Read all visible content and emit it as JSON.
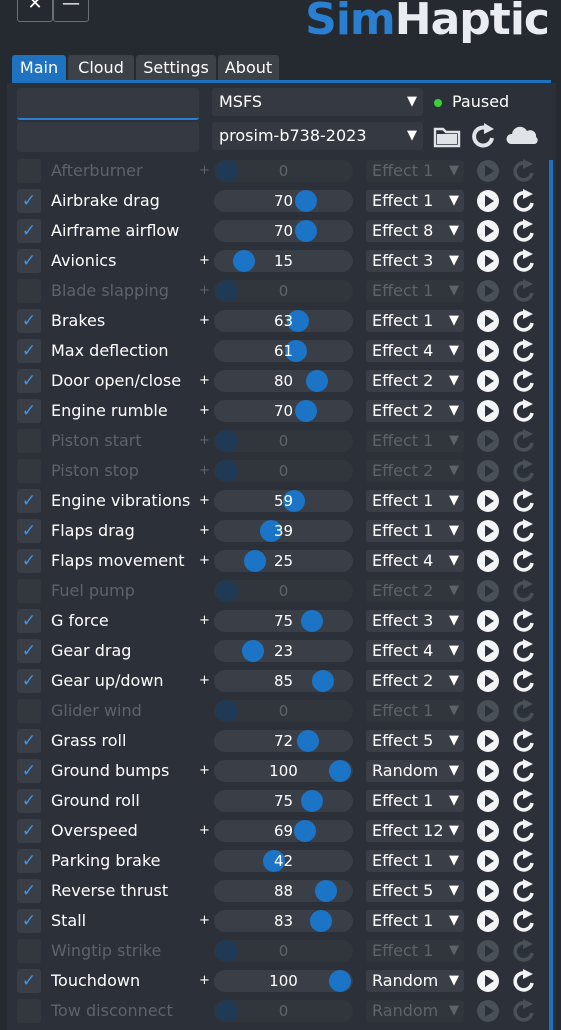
{
  "window": {
    "close_glyph": "✕",
    "minimize_glyph": "—",
    "logo_sim": "Sim",
    "logo_haptic": "Haptic"
  },
  "tabs": [
    {
      "label": "Main",
      "active": true
    },
    {
      "label": "Cloud",
      "active": false
    },
    {
      "label": "Settings",
      "active": false
    },
    {
      "label": "About",
      "active": false
    }
  ],
  "top": {
    "sim_select": "MSFS",
    "profile_select": "prosim-b738-2023",
    "status": "Paused",
    "status_color": "#3ad13a",
    "icons": [
      "folder-icon",
      "refresh-icon",
      "cloud-icon"
    ]
  },
  "effects": [
    {
      "label": "Afterburner",
      "enabled": false,
      "plus": true,
      "value": 0,
      "effect": "Effect 1"
    },
    {
      "label": "Airbrake drag",
      "enabled": true,
      "plus": false,
      "value": 70,
      "effect": "Effect 1"
    },
    {
      "label": "Airframe airflow",
      "enabled": true,
      "plus": false,
      "value": 70,
      "effect": "Effect 8"
    },
    {
      "label": "Avionics",
      "enabled": true,
      "plus": true,
      "value": 15,
      "effect": "Effect 3"
    },
    {
      "label": "Blade slapping",
      "enabled": false,
      "plus": true,
      "value": 0,
      "effect": "Effect 1"
    },
    {
      "label": "Brakes",
      "enabled": true,
      "plus": true,
      "value": 63,
      "effect": "Effect 1"
    },
    {
      "label": "Max deflection",
      "enabled": true,
      "plus": false,
      "value": 61,
      "effect": "Effect 4"
    },
    {
      "label": "Door open/close",
      "enabled": true,
      "plus": true,
      "value": 80,
      "effect": "Effect 2"
    },
    {
      "label": "Engine rumble",
      "enabled": true,
      "plus": true,
      "value": 70,
      "effect": "Effect 2"
    },
    {
      "label": "Piston start",
      "enabled": false,
      "plus": true,
      "value": 0,
      "effect": "Effect 1"
    },
    {
      "label": "Piston stop",
      "enabled": false,
      "plus": true,
      "value": 0,
      "effect": "Effect 2"
    },
    {
      "label": "Engine vibrations",
      "enabled": true,
      "plus": true,
      "value": 59,
      "effect": "Effect 1"
    },
    {
      "label": "Flaps drag",
      "enabled": true,
      "plus": true,
      "value": 39,
      "effect": "Effect 1"
    },
    {
      "label": "Flaps movement",
      "enabled": true,
      "plus": true,
      "value": 25,
      "effect": "Effect 4"
    },
    {
      "label": "Fuel pump",
      "enabled": false,
      "plus": false,
      "value": 0,
      "effect": "Effect 2"
    },
    {
      "label": "G force",
      "enabled": true,
      "plus": true,
      "value": 75,
      "effect": "Effect 3"
    },
    {
      "label": "Gear drag",
      "enabled": true,
      "plus": false,
      "value": 23,
      "effect": "Effect 4"
    },
    {
      "label": "Gear up/down",
      "enabled": true,
      "plus": true,
      "value": 85,
      "effect": "Effect 2"
    },
    {
      "label": "Glider wind",
      "enabled": false,
      "plus": false,
      "value": 0,
      "effect": "Effect 1"
    },
    {
      "label": "Grass roll",
      "enabled": true,
      "plus": false,
      "value": 72,
      "effect": "Effect 5"
    },
    {
      "label": "Ground bumps",
      "enabled": true,
      "plus": true,
      "value": 100,
      "effect": "Random"
    },
    {
      "label": "Ground roll",
      "enabled": true,
      "plus": false,
      "value": 75,
      "effect": "Effect 1"
    },
    {
      "label": "Overspeed",
      "enabled": true,
      "plus": true,
      "value": 69,
      "effect": "Effect 12"
    },
    {
      "label": "Parking brake",
      "enabled": true,
      "plus": false,
      "value": 42,
      "effect": "Effect 1"
    },
    {
      "label": "Reverse thrust",
      "enabled": true,
      "plus": false,
      "value": 88,
      "effect": "Effect 5"
    },
    {
      "label": "Stall",
      "enabled": true,
      "plus": true,
      "value": 83,
      "effect": "Effect 1"
    },
    {
      "label": "Wingtip strike",
      "enabled": false,
      "plus": false,
      "value": 0,
      "effect": "Effect 1"
    },
    {
      "label": "Touchdown",
      "enabled": true,
      "plus": true,
      "value": 100,
      "effect": "Random"
    },
    {
      "label": "Tow disconnect",
      "enabled": false,
      "plus": false,
      "value": 0,
      "effect": "Random"
    }
  ],
  "glyphs": {
    "check": "✓",
    "plus": "+",
    "dropdown_arrow": "▼"
  },
  "colors": {
    "accent": "#1f72c0",
    "knob": "#1c74c6",
    "status_dot": "#3ad13a"
  }
}
